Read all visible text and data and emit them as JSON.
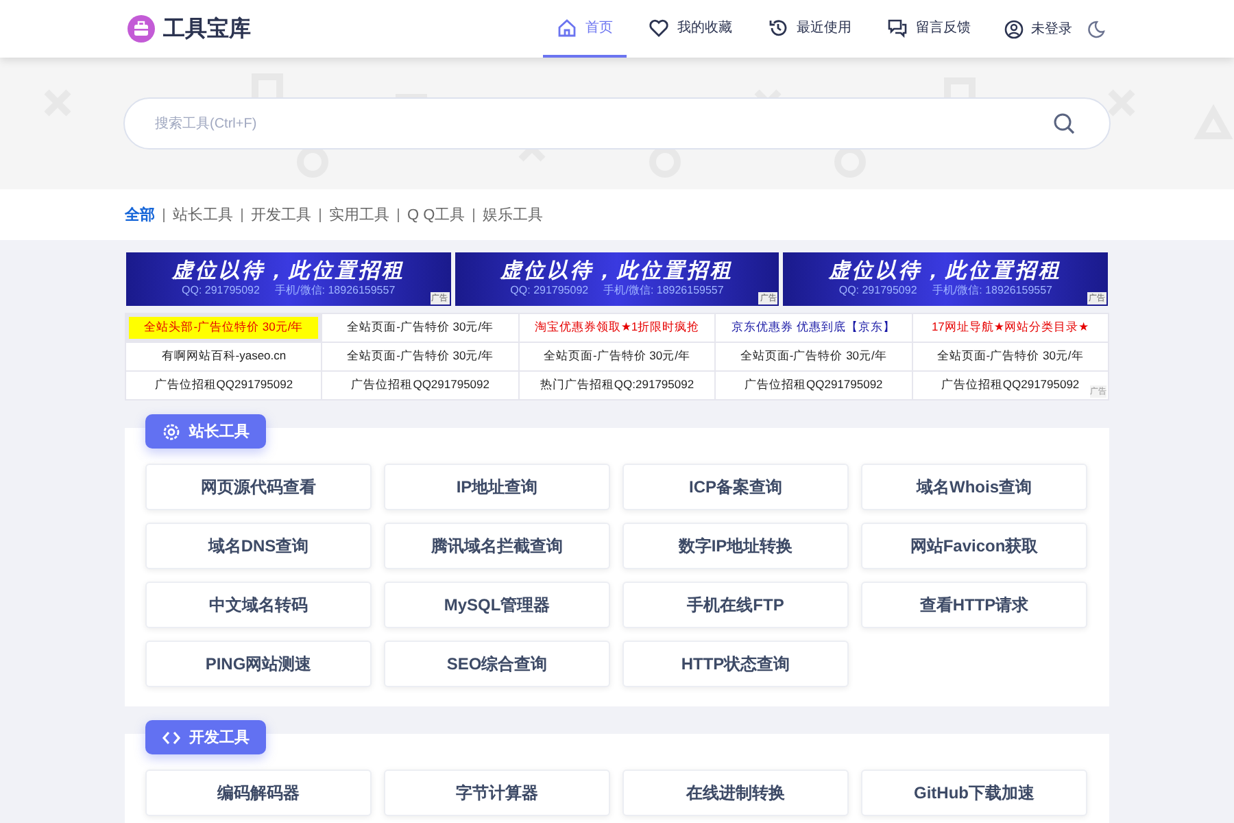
{
  "header": {
    "logo": "工具宝库",
    "nav": [
      {
        "label": "首页",
        "selected": true
      },
      {
        "label": "我的收藏",
        "selected": false
      },
      {
        "label": "最近使用",
        "selected": false
      },
      {
        "label": "留言反馈",
        "selected": false
      }
    ],
    "user": "未登录"
  },
  "search": {
    "placeholder": "搜索工具(Ctrl+F)"
  },
  "categories": [
    {
      "label": "全部",
      "selected": true
    },
    {
      "label": "站长工具",
      "selected": false
    },
    {
      "label": "开发工具",
      "selected": false
    },
    {
      "label": "实用工具",
      "selected": false
    },
    {
      "label": "Q Q工具",
      "selected": false
    },
    {
      "label": "娱乐工具",
      "selected": false
    }
  ],
  "banners": [
    {
      "headline": "虚位以待，此位置招租",
      "contact": "QQ: 291795092     手机/微信: 18926159557",
      "tag": "广告"
    },
    {
      "headline": "虚位以待，此位置招租",
      "contact": "QQ: 291795092     手机/微信: 18926159557",
      "tag": "广告"
    },
    {
      "headline": "虚位以待，此位置招租",
      "contact": "QQ: 291795092     手机/微信: 18926159557",
      "tag": "广告"
    }
  ],
  "text_ads": [
    [
      {
        "text": "全站头部-广告位特价 30元/年",
        "color": "#e60000",
        "highlighted": true
      },
      {
        "text": "全站页面-广告特价 30元/年",
        "color": "#222222",
        "highlighted": false
      },
      {
        "text": "淘宝优惠券领取★1折限时疯抢",
        "color": "#e60000",
        "highlighted": false
      },
      {
        "text": "京东优惠券 优惠到底【京东】",
        "color": "#1a1aa6",
        "highlighted": false
      },
      {
        "text": "17网址导航★网站分类目录★",
        "color": "#e60000",
        "highlighted": false
      }
    ],
    [
      {
        "text": "有啊网站百科-yaseo.cn",
        "color": "#222222",
        "highlighted": false
      },
      {
        "text": "全站页面-广告特价 30元/年",
        "color": "#222222",
        "highlighted": false
      },
      {
        "text": "全站页面-广告特价 30元/年",
        "color": "#222222",
        "highlighted": false
      },
      {
        "text": "全站页面-广告特价 30元/年",
        "color": "#222222",
        "highlighted": false
      },
      {
        "text": "全站页面-广告特价 30元/年",
        "color": "#222222",
        "highlighted": false
      }
    ],
    [
      {
        "text": "广告位招租QQ291795092",
        "color": "#222222",
        "highlighted": false
      },
      {
        "text": "广告位招租QQ291795092",
        "color": "#222222",
        "highlighted": false
      },
      {
        "text": "热门广告招租QQ:291795092",
        "color": "#222222",
        "highlighted": false
      },
      {
        "text": "广告位招租QQ291795092",
        "color": "#222222",
        "highlighted": false
      },
      {
        "text": "广告位招租QQ291795092",
        "color": "#222222",
        "highlighted": false
      }
    ]
  ],
  "text_ads_tag": "广告",
  "sections": [
    {
      "title": "站长工具",
      "tools": [
        "网页源代码查看",
        "IP地址查询",
        "ICP备案查询",
        "域名Whois查询",
        "域名DNS查询",
        "腾讯域名拦截查询",
        "数字IP地址转换",
        "网站Favicon获取",
        "中文域名转码",
        "MySQL管理器",
        "手机在线FTP",
        "查看HTTP请求",
        "PING网站测速",
        "SEO综合查询",
        "HTTP状态查询"
      ]
    },
    {
      "title": "开发工具",
      "tools": [
        "编码解码器",
        "字节计算器",
        "在线进制转换",
        "GitHub下载加速"
      ]
    }
  ]
}
